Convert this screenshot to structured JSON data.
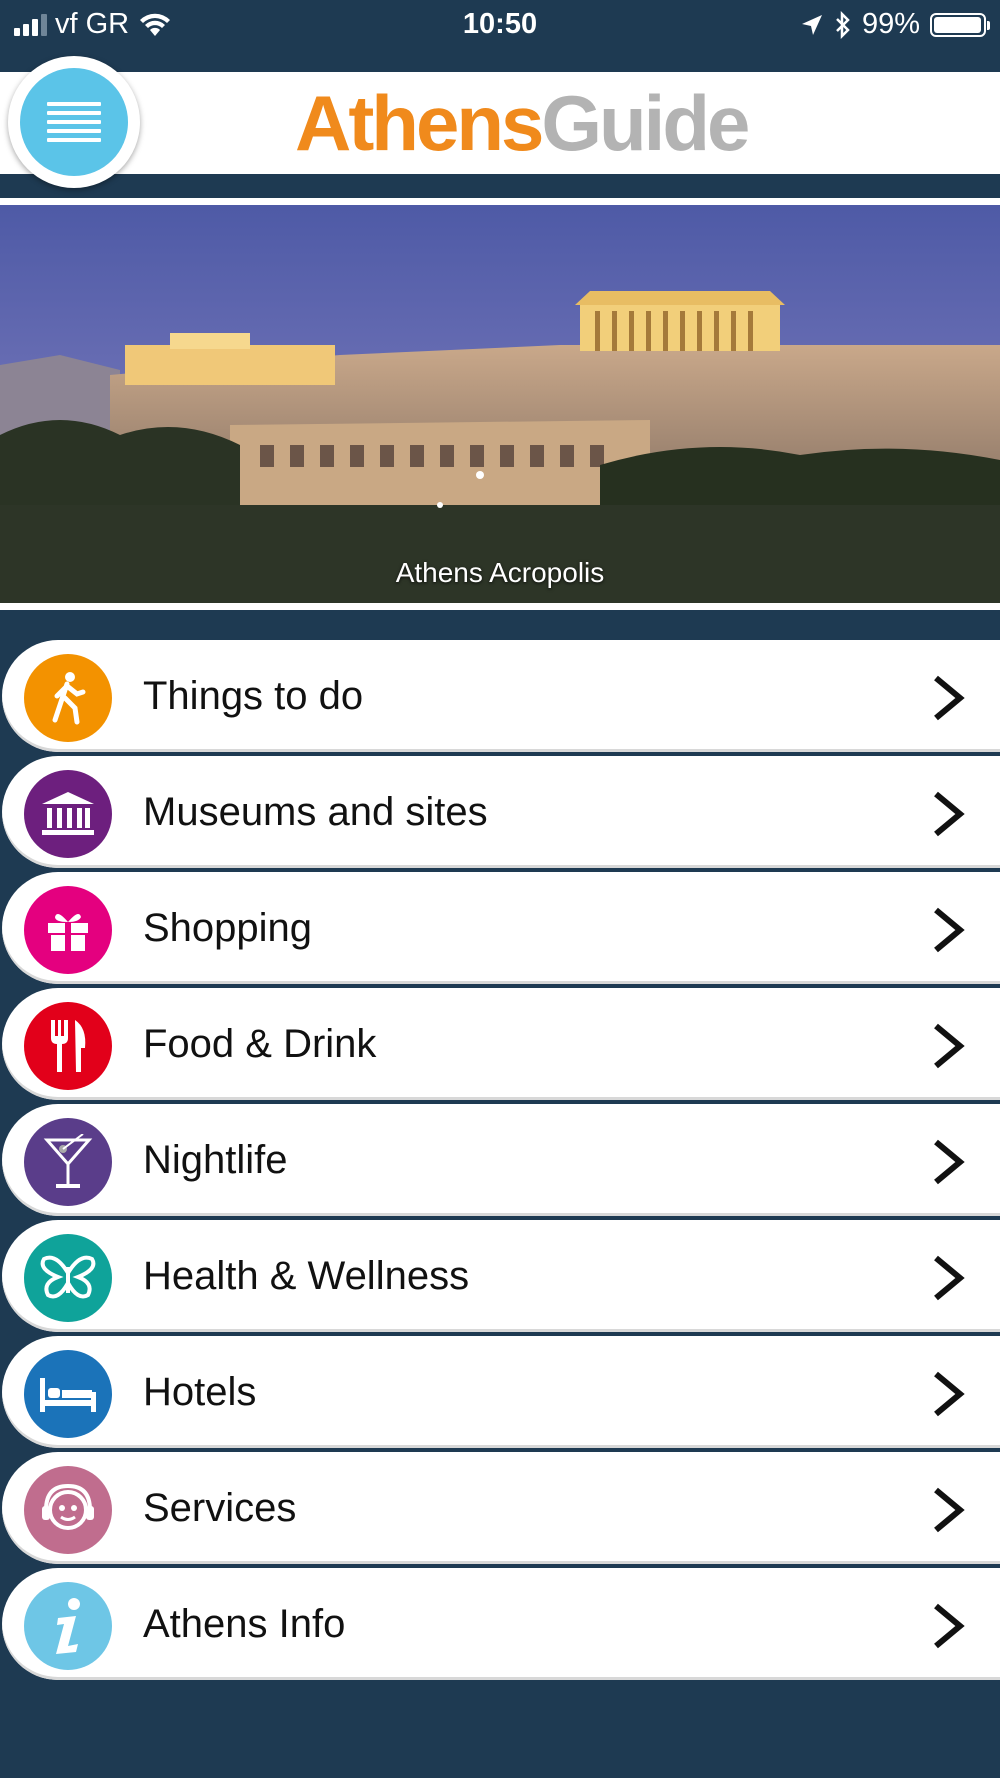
{
  "status_bar": {
    "carrier": "vf GR",
    "time": "10:50",
    "battery": "99%"
  },
  "header": {
    "logo_part1": "Athens",
    "logo_part2": "Guide"
  },
  "hero": {
    "caption": "Athens Acropolis"
  },
  "menu": [
    {
      "label": "Things to do",
      "icon": "walking-person-icon",
      "color": "#f39200"
    },
    {
      "label": "Museums and sites",
      "icon": "museum-building-icon",
      "color": "#6d1f7e"
    },
    {
      "label": "Shopping",
      "icon": "gift-icon",
      "color": "#e4007f"
    },
    {
      "label": "Food & Drink",
      "icon": "fork-knife-icon",
      "color": "#e2001a"
    },
    {
      "label": "Nightlife",
      "icon": "cocktail-glass-icon",
      "color": "#5a3d8a"
    },
    {
      "label": "Health & Wellness",
      "icon": "butterfly-icon",
      "color": "#0fa39a"
    },
    {
      "label": "Hotels",
      "icon": "bed-icon",
      "color": "#1b73b9"
    },
    {
      "label": "Services",
      "icon": "headset-person-icon",
      "color": "#c06d8e"
    },
    {
      "label": "Athens Info",
      "icon": "info-icon",
      "color": "#6ec6e6"
    }
  ]
}
